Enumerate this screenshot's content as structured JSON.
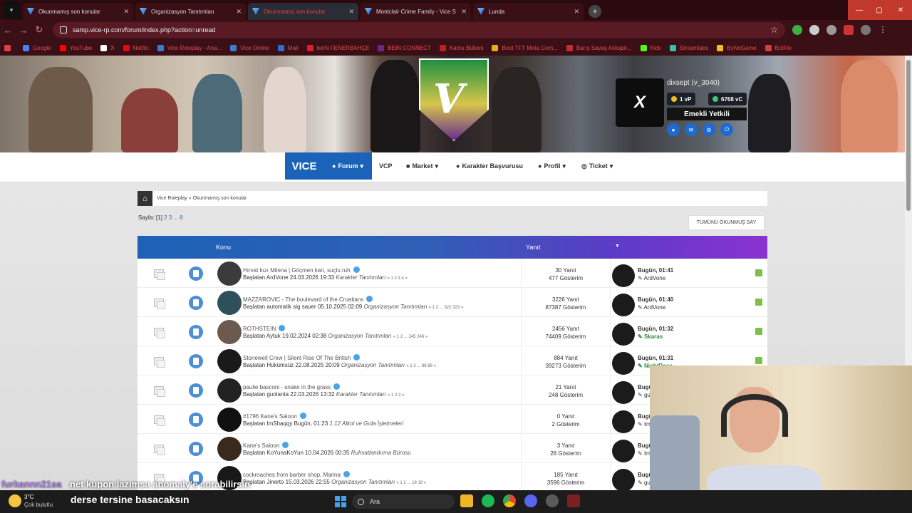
{
  "browser": {
    "tabs": [
      {
        "label": "Okunmamış son konular",
        "active": false
      },
      {
        "label": "Organizasyon Tanıtımları",
        "active": false
      },
      {
        "label": "Okunmamış son konular",
        "active": true
      },
      {
        "label": "Montclair Crime Family - Vice S",
        "active": false
      },
      {
        "label": "Lunda",
        "active": false
      }
    ],
    "tab_close": "✕",
    "new_tab": "+",
    "url": "samp.vice-rp.com/forum/index.php?action=unread",
    "bookmarks": [
      {
        "label": "Google",
        "color": "#4285f4"
      },
      {
        "label": "YouTube",
        "color": "#ff0000"
      },
      {
        "label": "X",
        "color": "#ffffff"
      },
      {
        "label": "Netflix",
        "color": "#e50914"
      },
      {
        "label": "Vice Roleplay - Ana...",
        "color": "#3a7bd5"
      },
      {
        "label": "Vice Online",
        "color": "#3a7bd5"
      },
      {
        "label": "Mail",
        "color": "#2f6fd1"
      },
      {
        "label": "beIN FENERBAHÇE",
        "color": "#e0201e"
      },
      {
        "label": "BEIN CONNECT",
        "color": "#6a2a8a"
      },
      {
        "label": "Kamu Bülteni",
        "color": "#c02020"
      },
      {
        "label": "Best TFT Meta Com...",
        "color": "#e0b020"
      },
      {
        "label": "Barış Savaş Akkaplı...",
        "color": "#c03030"
      },
      {
        "label": "Kick",
        "color": "#53fc18"
      },
      {
        "label": "Streamlabs",
        "color": "#31c3a2"
      },
      {
        "label": "ByNoGame",
        "color": "#f0c020"
      },
      {
        "label": "BotRix",
        "color": "#d04040"
      }
    ]
  },
  "banner": {
    "username": "dixsept (v_3040)",
    "vp": "1 vP",
    "vc": "6768 vC",
    "rank": "Emekli Yetkili"
  },
  "nav": {
    "logo": "VICE",
    "items": [
      "Forum",
      "VCP",
      "Market",
      "Karakter Başvurusu",
      "Profil",
      "Ticket"
    ]
  },
  "breadcrumb": {
    "root": "Vice Roleplay",
    "sep": "»",
    "current": "Okunmamış son konular"
  },
  "pager": {
    "prefix": "Sayfa:",
    "current": "[1]",
    "pages": "2 3 ... 8"
  },
  "mark_all_read": "TÜMÜNÜ OKUNMUŞ SAY",
  "table": {
    "col_topic": "Konu",
    "col_replies": "Yanıt",
    "sort_icon": "▼",
    "rows": [
      {
        "title": "Hırvat kızı Milena | Göçmen kan, suçlu ruh",
        "starter": "Başlatan ArdVone 24.03.2026 19:33",
        "category": "Karakter Tanıtımları",
        "pages": "« 1 2 3 4 »",
        "replies": "30 Yanıt",
        "views": "477 Gösterim",
        "last_time": "Bugün, 01:41",
        "last_user": "ArdVone",
        "green": false
      },
      {
        "title": "MAZZAROVIC - The boulevard of the Croatians",
        "starter": "Başlatan automatik sig sauer 05.10.2025 02:09",
        "category": "Organizasyon Tanıtımları",
        "pages": "« 1 2 ... 322 323 »",
        "replies": "3226 Yanıt",
        "views": "87387 Gösterim",
        "last_time": "Bugün, 01:40",
        "last_user": "ArdVone",
        "green": false
      },
      {
        "title": "ROTHSTEIN",
        "starter": "Başlatan Aytuk 19.02.2024 02:38",
        "category": "Organizasyon Tanıtımları",
        "pages": "« 1 2 ... 245 246 »",
        "replies": "2456 Yanıt",
        "views": "74409 Gösterim",
        "last_time": "Bugün, 01:32",
        "last_user": "Skaras",
        "green": true
      },
      {
        "title": "Stonewell Crew | Silent Rise Of The British",
        "starter": "Başlatan Hükümsüz 22.08.2025 20:09",
        "category": "Organizasyon Tanıtımları",
        "pages": "« 1 2 ... 88 89 »",
        "replies": "884 Yanıt",
        "views": "39273 Gösterim",
        "last_time": "Bugün, 01:31",
        "last_user": "NightRose",
        "green": true
      },
      {
        "title": "paulie basconi - snake in the grass",
        "starter": "Başlatan gunlanta 22.03.2026 13:32",
        "category": "Karakter Tanıtımları",
        "pages": "« 1 2 3 »",
        "replies": "21 Yanıt",
        "views": "248 Gösterim",
        "last_time": "Bugün",
        "last_user": "gu",
        "green": false
      },
      {
        "title": "#1796 Kane's Saloon",
        "starter": "Başlatan ImShaqqy Bugün, 01:23",
        "category": "1.12 Alkol ve Gıda İşletmeleri",
        "pages": "",
        "replies": "0 Yanıt",
        "views": "2 Gösterim",
        "last_time": "Bugün",
        "last_user": "Im",
        "green": false
      },
      {
        "title": "Kane's Saloon",
        "starter": "Başlatan KoYunaKoYun 10.04.2026 00:35",
        "category": "Ruhsatlandırma Bürosu",
        "pages": "",
        "replies": "3 Yanıt",
        "views": "28 Gösterim",
        "last_time": "Bugün",
        "last_user": "Im",
        "green": false
      },
      {
        "title": "cockroaches from barber shop, Marina",
        "starter": "Başlatan Jinerto 15.03.2026 22:55",
        "category": "Organizasyon Tanıtımları",
        "pages": "« 1 2 ... 18 19 »",
        "replies": "185 Yanıt",
        "views": "3596 Gösterim",
        "last_time": "Bugün",
        "last_user": "gu",
        "green": false
      }
    ]
  },
  "chat": {
    "user": "furkannn21sa",
    "message": "net kupon lazımsa anomaly'e sorabilirsin"
  },
  "taskbar": {
    "temp": "3°C",
    "weather": "Çok bulutlu",
    "subtitle": "derse tersine basacaksın",
    "search": "Ara"
  }
}
